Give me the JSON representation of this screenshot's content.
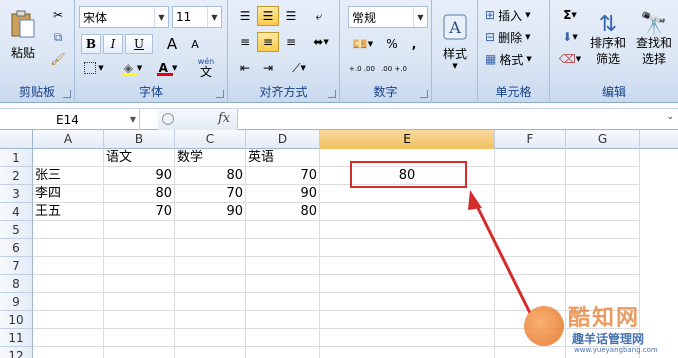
{
  "ribbon": {
    "clipboard": {
      "label": "剪贴板",
      "paste": "粘贴"
    },
    "font": {
      "label": "字体",
      "font_name": "宋体",
      "font_size": "11",
      "bold": "B",
      "italic": "I",
      "underline": "U",
      "grow": "A",
      "shrink": "A",
      "font_color_glyph": "A",
      "wen": "wén",
      "wen_char": "文"
    },
    "alignment": {
      "label": "对齐方式"
    },
    "number": {
      "label": "数字",
      "format": "常规",
      "percent": "%",
      "comma": ",",
      "inc_decimal": "+.0 .00",
      "dec_decimal": ".00 +.0"
    },
    "styles": {
      "label": "样式",
      "button": "样式"
    },
    "cells": {
      "label": "单元格",
      "insert": "插入",
      "delete": "删除",
      "format": "格式"
    },
    "editing": {
      "label": "编辑",
      "sort": "排序和",
      "sort2": "筛选",
      "find": "查找和",
      "find2": "选择"
    }
  },
  "formula_bar": {
    "name_box": "E14",
    "fx": "fx",
    "content": ""
  },
  "grid": {
    "columns": [
      "A",
      "B",
      "C",
      "D",
      "E",
      "F",
      "G"
    ],
    "selected_column": "E",
    "rows": [
      "1",
      "2",
      "3",
      "4",
      "5",
      "6",
      "7",
      "8",
      "9",
      "10",
      "11",
      "12"
    ],
    "cells": {
      "B1": "语文",
      "C1": "数学",
      "D1": "英语",
      "A2": "张三",
      "B2": "90",
      "C2": "80",
      "D2": "70",
      "E2": "80",
      "A3": "李四",
      "B3": "80",
      "C3": "70",
      "D3": "90",
      "A4": "王五",
      "B4": "70",
      "C4": "90",
      "D4": "80"
    }
  },
  "annotation": {
    "box_color": "#d62b2b",
    "arrow_color": "#d62b2b"
  },
  "watermark": {
    "brand": "酷知网",
    "site_cn": "趣羊话管理网",
    "site_url": "www.yueyangbang.com"
  }
}
